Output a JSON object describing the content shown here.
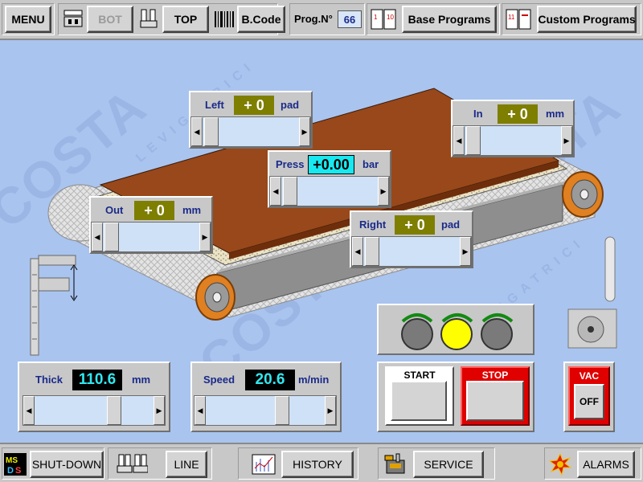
{
  "topbar": {
    "menu": "MENU",
    "bot": "BOT",
    "top": "TOP",
    "barcode": "B.Code",
    "prog_label": "Prog.N°",
    "prog_value": "66",
    "base_programs": "Base Programs",
    "custom_programs": "Custom Programs"
  },
  "watermark": {
    "brand": "COSTA",
    "sub": "LEVIGATRICI"
  },
  "params": {
    "left": {
      "label": "Left",
      "value": "+ 0",
      "unit": "pad"
    },
    "in": {
      "label": "In",
      "value": "+ 0",
      "unit": "mm"
    },
    "press": {
      "label": "Press",
      "value": "+0.00",
      "unit": "bar"
    },
    "out": {
      "label": "Out",
      "value": "+ 0",
      "unit": "mm"
    },
    "right": {
      "label": "Right",
      "value": "+ 0",
      "unit": "pad"
    },
    "thick": {
      "label": "Thick",
      "value": "110.6",
      "unit": "mm"
    },
    "speed": {
      "label": "Speed",
      "value": "20.6",
      "unit": "m/min"
    }
  },
  "controls": {
    "start": "START",
    "stop": "STOP",
    "vac_label": "VAC",
    "vac_state": "OFF"
  },
  "bottombar": {
    "shutdown": "SHUT-DOWN",
    "line": "LINE",
    "history": "HISTORY",
    "service": "SERVICE",
    "alarms": "ALARMS"
  },
  "colors": {
    "panel_value_bg": "#7e7e00",
    "press_value_bg": "#18e8ef",
    "lamp_on": "#ffff00",
    "stop_red": "#e00000"
  }
}
